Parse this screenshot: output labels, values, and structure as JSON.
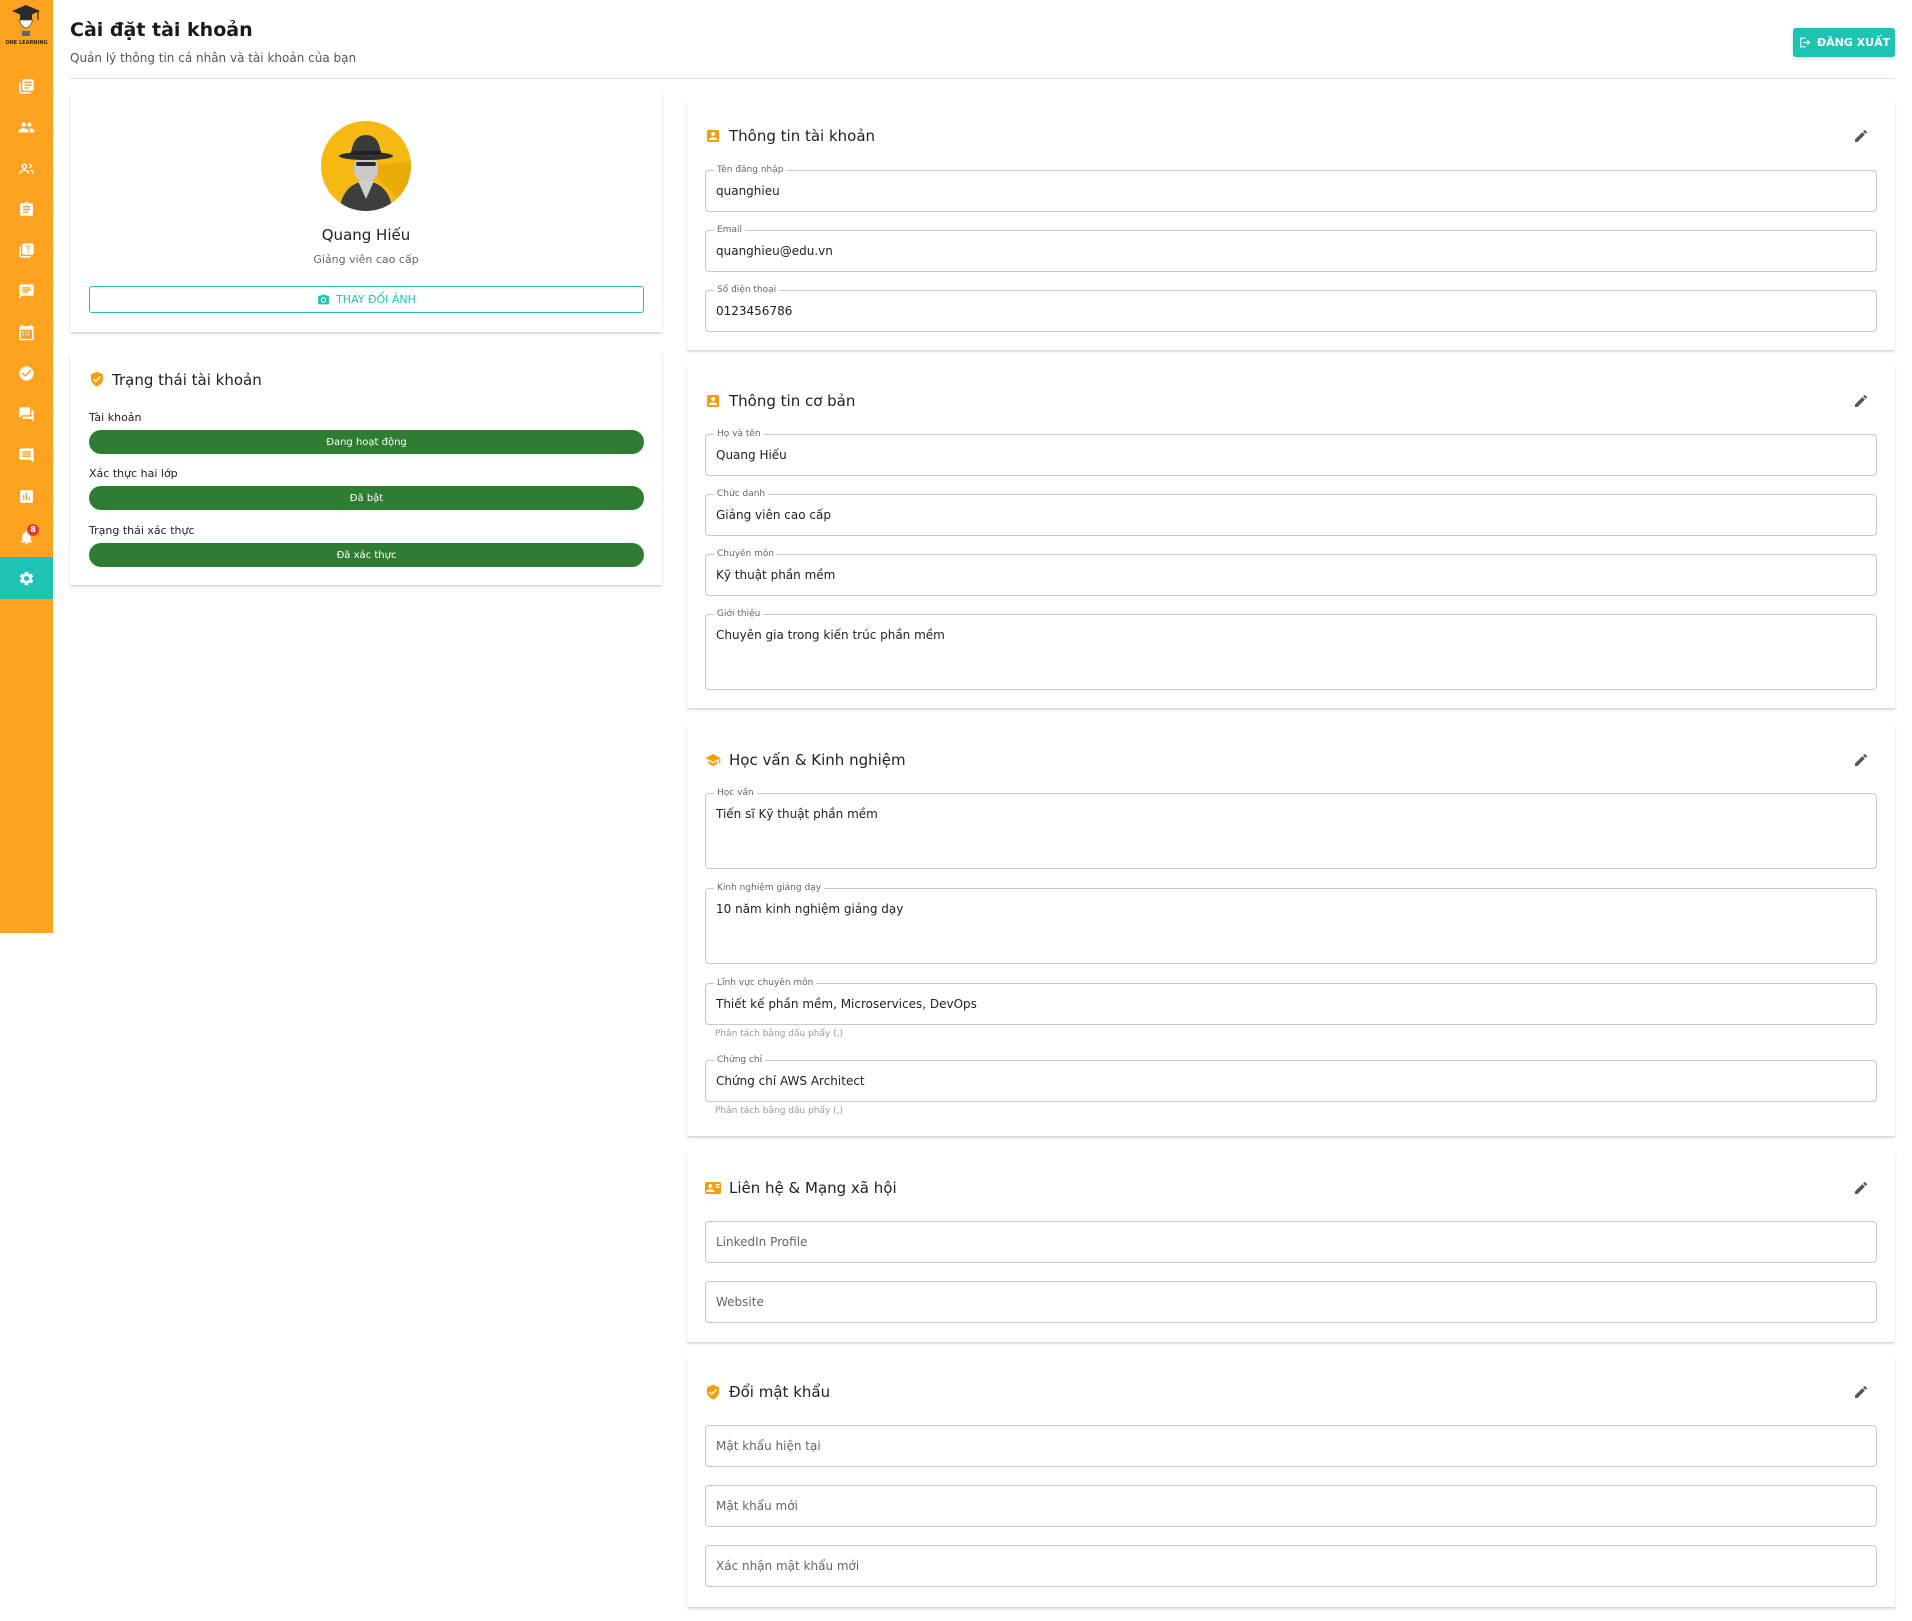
{
  "brand": {
    "logo_text": "ONE LEARNING"
  },
  "sidebar": {
    "items": [
      {
        "icon": "book-icon"
      },
      {
        "icon": "users-icon"
      },
      {
        "icon": "group-icon"
      },
      {
        "icon": "clipboard-icon"
      },
      {
        "icon": "quiz-icon"
      },
      {
        "icon": "chat-icon"
      },
      {
        "icon": "calendar-icon"
      },
      {
        "icon": "check-circle-icon"
      },
      {
        "icon": "forum-icon"
      },
      {
        "icon": "comment-icon"
      },
      {
        "icon": "report-icon"
      },
      {
        "icon": "bell-icon",
        "badge": "8"
      },
      {
        "icon": "gear-icon",
        "active": true
      }
    ]
  },
  "header": {
    "title": "Cài đặt tài khoản",
    "subtitle": "Quản lý thông tin cá nhân và tài khoản của bạn",
    "logout_label": "ĐĂNG XUẤT"
  },
  "profile": {
    "name": "Quang Hiếu",
    "role": "Giảng viên cao cấp",
    "change_photo_label": "THAY ĐỔI ẢNH"
  },
  "status": {
    "title": "Trạng thái tài khoản",
    "items": [
      {
        "label": "Tài khoản",
        "value": "Đang hoạt động"
      },
      {
        "label": "Xác thực hai lớp",
        "value": "Đã bật"
      },
      {
        "label": "Trạng thái xác thực",
        "value": "Đã xác thực"
      }
    ]
  },
  "account_info": {
    "title": "Thông tin tài khoản",
    "fields": [
      {
        "label": "Tên đăng nhập",
        "value": "quanghieu"
      },
      {
        "label": "Email",
        "value": "quanghieu@edu.vn"
      },
      {
        "label": "Số điện thoại",
        "value": "0123456786"
      }
    ]
  },
  "basic_info": {
    "title": "Thông tin cơ bản",
    "fields": [
      {
        "label": "Họ và tên",
        "value": "Quang Hiếu"
      },
      {
        "label": "Chức danh",
        "value": "Giảng viên cao cấp"
      },
      {
        "label": "Chuyên môn",
        "value": "Kỹ thuật phần mềm"
      },
      {
        "label": "Giới thiệu",
        "value": "Chuyên gia trong kiến trúc phần mềm"
      }
    ]
  },
  "education": {
    "title": "Học vấn & Kinh nghiệm",
    "fields": [
      {
        "label": "Học vấn",
        "value": "Tiến sĩ Kỹ thuật phần mềm"
      },
      {
        "label": "Kinh nghiệm giảng dạy",
        "value": "10 năm kinh nghiệm giảng dạy"
      },
      {
        "label": "Lĩnh vực chuyên môn",
        "value": "Thiết kế phần mềm, Microservices, DevOps",
        "helper": "Phân tách bằng dấu phẩy (,)"
      },
      {
        "label": "Chứng chỉ",
        "value": "Chứng chỉ AWS Architect",
        "helper": "Phân tách bằng dấu phẩy (,)"
      }
    ]
  },
  "contact": {
    "title": "Liên hệ & Mạng xã hội",
    "fields": [
      {
        "placeholder": "LinkedIn Profile"
      },
      {
        "placeholder": "Website"
      }
    ]
  },
  "password": {
    "title": "Đổi mật khẩu",
    "fields": [
      {
        "placeholder": "Mật khẩu hiện tại"
      },
      {
        "placeholder": "Mật khẩu mới"
      },
      {
        "placeholder": "Xác nhận mật khẩu mới"
      }
    ]
  },
  "colors": {
    "sidebar": "#FFA21F",
    "accent": "#1FC3B3",
    "status_green": "#2E7D32",
    "section_icon": "#F59E0B",
    "badge": "#E53935"
  }
}
